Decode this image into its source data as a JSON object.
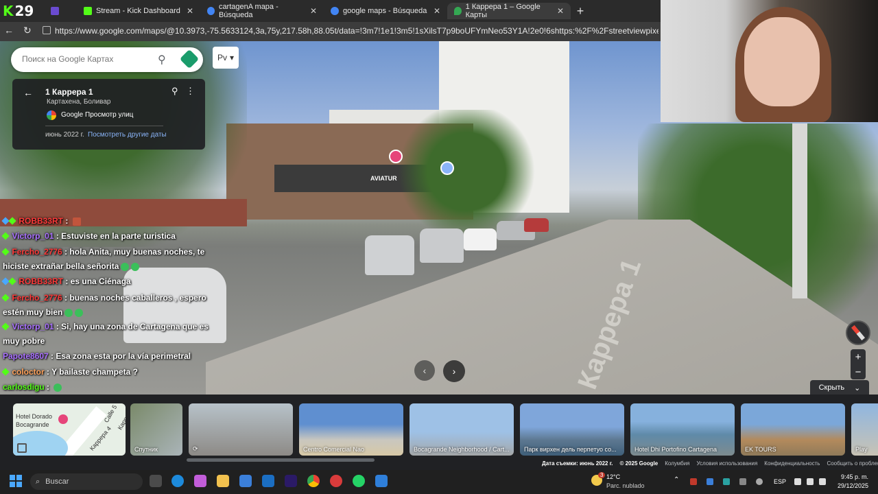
{
  "browser": {
    "stream_count": "29",
    "tabs": [
      {
        "label": "Stream - Kick Dashboard"
      },
      {
        "label": "cartagenA mapa - Búsqueda"
      },
      {
        "label": "google maps - Búsqueda"
      },
      {
        "label": "1 Каррера 1 – Google Карты"
      }
    ],
    "url": "https://www.google.com/maps/@10.3973,-75.5633124,3a,75y,217.58h,88.05t/data=!3m7!1e1!3m5!1sXilsT7p9boUFYmNeo53Y1A!2e0!6shttps:%2F%2Fstreetviewpixels-pa.googleapis.com%2Fv1"
  },
  "maps": {
    "search_placeholder": "Поиск на Google Картах",
    "lang_label": "Рv",
    "info": {
      "title": "1 Каррера 1",
      "subtitle": "Картахена, Боливар",
      "source": "Google Просмотр улиц",
      "date": "июнь 2022 г.",
      "other_dates": "Посмотреть другие даты"
    },
    "street_label": "Каррера 1",
    "sign_text": "AVIATUR",
    "hide_label": "Скрыть",
    "footer": {
      "capture_date": "Дата съемки: июнь 2022 г.",
      "copyright": "© 2025 Google",
      "country": "Колумбия",
      "terms": "Условия использования",
      "privacy": "Конфиденциальность",
      "report": "Сообщить о проблеме"
    },
    "thumbs": [
      {
        "caption": "Спутник"
      },
      {
        "caption": ""
      },
      {
        "caption": "Centro Comercial Nao"
      },
      {
        "caption": "Bocagrande Neighborhood / Cart..."
      },
      {
        "caption": "Парк вирхен дель перпетуо со..."
      },
      {
        "caption": "Hotel Dhi Portofino Cartagena"
      },
      {
        "caption": "EK TOURS"
      },
      {
        "caption": "Play"
      }
    ],
    "map_labels": {
      "hotel": "Hotel Dorado",
      "district": "Bocagrande",
      "street_a": "Каррера 4",
      "street_b": "Calle 5",
      "street_c": "Карр"
    }
  },
  "chat": [
    {
      "user": "ROBB33RT",
      "text": "",
      "color": "red"
    },
    {
      "user": "Victorp_01",
      "text": "Estuviste en la parte turistica",
      "color": "purple"
    },
    {
      "user": "Fercho_2776",
      "text": "hola Anita, muy buenas noches, te hiciste extrañar bella señorita",
      "color": "red"
    },
    {
      "user": "ROBB33RT",
      "text": "es una Ciénaga",
      "color": "red"
    },
    {
      "user": "Fercho_2776",
      "text": "buenas noches caballeros , espero estén muy bien",
      "color": "red"
    },
    {
      "user": "Victorp_01",
      "text": "Si, hay una zona de Cartagena que es muy pobre",
      "color": "purple"
    },
    {
      "user": "Papote8607",
      "text": "Esa zona esta por la vía perimetral",
      "color": "purple"
    },
    {
      "user": "coloctor",
      "text": "Y bailaste champeta ?",
      "color": "orange"
    },
    {
      "user": "carlosdigu",
      "text": "",
      "color": "green"
    }
  ],
  "taskbar": {
    "search_label": "Buscar",
    "weather_temp": "12°C",
    "weather_desc": "Parc. nublado",
    "weather_alert": "3",
    "lang": "ESP",
    "time": "9:45 p. m.",
    "date": "29/12/2025"
  },
  "colors": {
    "kick_green": "#53fc18",
    "maps_link": "#8ab4f8",
    "chat_red": "#ff3a3a",
    "chat_purple": "#a970ff"
  }
}
